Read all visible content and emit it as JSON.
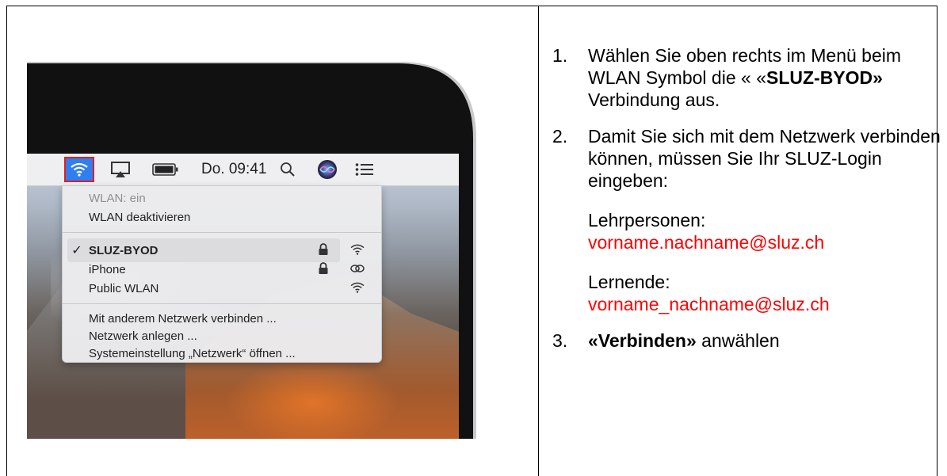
{
  "menubar": {
    "clock": "Do. 09:41"
  },
  "wifi_menu": {
    "status": "WLAN: ein",
    "disable": "WLAN deaktivieren",
    "networks": [
      {
        "name": "SLUZ-BYOD",
        "checked": true,
        "lock": true,
        "icon": "wifi-icon"
      },
      {
        "name": "iPhone",
        "checked": false,
        "lock": true,
        "icon": "hotspot-link-icon"
      },
      {
        "name": "Public WLAN",
        "checked": false,
        "lock": false,
        "icon": "wifi-icon"
      }
    ],
    "other_network": "Mit anderem Netzwerk verbinden ...",
    "create_network": "Netzwerk anlegen ...",
    "open_prefs": "Systemeinstellung „Netzwerk“ öffnen ..."
  },
  "steps": {
    "s1": {
      "num": "1.",
      "text_a": "Wählen Sie oben rechts im Menü beim WLAN Symbol die « «",
      "bold": "SLUZ-BYOD»",
      "text_b": " Verbindung aus."
    },
    "s2": {
      "num": "2.",
      "text": "Damit Sie sich mit dem Netzwerk verbinden können, müssen Sie Ihr SLUZ-Login eingeben:",
      "teachers_label": "Lehrpersonen:",
      "teachers_login": "vorname.nachname@sluz.ch",
      "learners_label": "Lernende:",
      "learners_login": "vorname_nachname@sluz.ch"
    },
    "s3": {
      "num": "3.",
      "bold": "«Verbinden»",
      "text": " anwählen"
    }
  },
  "colors": {
    "accent": "#2f7ff0",
    "highlight_border": "#e02020",
    "login_text": "#ff0000"
  }
}
